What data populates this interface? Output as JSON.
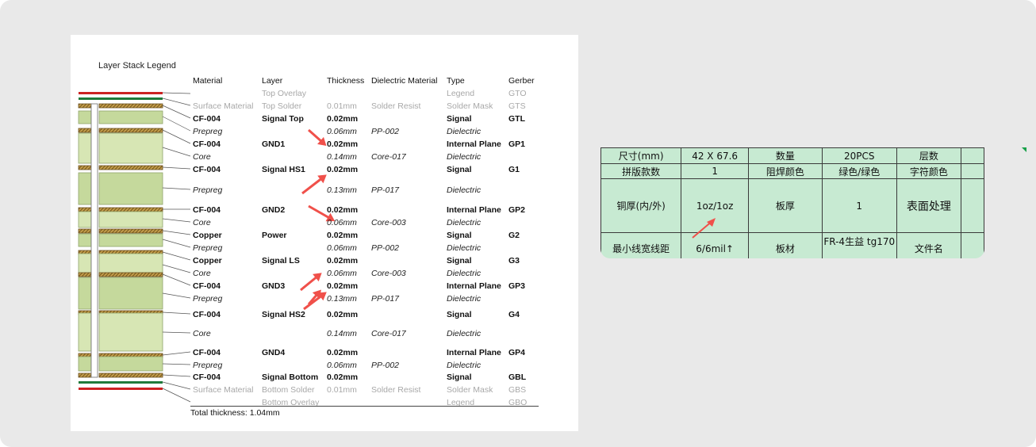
{
  "legend": {
    "title": "Layer Stack Legend",
    "headers": {
      "material": "Material",
      "layer": "Layer",
      "thickness": "Thickness",
      "dielectric": "Dielectric Material",
      "type": "Type",
      "gerber": "Gerber"
    },
    "rows": [
      {
        "style": "gray",
        "material": "",
        "layer": "Top Overlay",
        "thickness": "",
        "dielectric": "",
        "type": "Legend",
        "gerber": "GTO"
      },
      {
        "style": "gray",
        "material": "Surface Material",
        "layer": "Top Solder",
        "thickness": "0.01mm",
        "dielectric": "Solder Resist",
        "type": "Solder Mask",
        "gerber": "GTS"
      },
      {
        "style": "bold",
        "material": "CF-004",
        "layer": "Signal Top",
        "thickness": "0.02mm",
        "dielectric": "",
        "type": "Signal",
        "gerber": "GTL"
      },
      {
        "style": "ital",
        "material": "Prepreg",
        "layer": "",
        "thickness": "0.06mm",
        "dielectric": "PP-002",
        "type": "Dielectric",
        "gerber": ""
      },
      {
        "style": "bold",
        "material": "CF-004",
        "layer": "GND1",
        "thickness": "0.02mm",
        "dielectric": "",
        "type": "Internal Plane",
        "gerber": "GP1"
      },
      {
        "style": "ital",
        "material": "Core",
        "layer": "",
        "thickness": "0.14mm",
        "dielectric": "Core-017",
        "type": "Dielectric",
        "gerber": ""
      },
      {
        "style": "bold",
        "material": "CF-004",
        "layer": "Signal HS1",
        "thickness": "0.02mm",
        "dielectric": "",
        "type": "Signal",
        "gerber": "G1"
      },
      {
        "style": "ital",
        "material": "Prepreg",
        "layer": "",
        "thickness": "0.13mm",
        "dielectric": "PP-017",
        "type": "Dielectric",
        "gerber": ""
      },
      {
        "style": "bold",
        "material": "CF-004",
        "layer": "GND2",
        "thickness": "0.02mm",
        "dielectric": "",
        "type": "Internal Plane",
        "gerber": "GP2"
      },
      {
        "style": "ital",
        "material": "Core",
        "layer": "",
        "thickness": "0.06mm",
        "dielectric": "Core-003",
        "type": "Dielectric",
        "gerber": ""
      },
      {
        "style": "bold",
        "material": "Copper",
        "layer": "Power",
        "thickness": "0.02mm",
        "dielectric": "",
        "type": "Signal",
        "gerber": "G2"
      },
      {
        "style": "ital",
        "material": "Prepreg",
        "layer": "",
        "thickness": "0.06mm",
        "dielectric": "PP-002",
        "type": "Dielectric",
        "gerber": ""
      },
      {
        "style": "bold",
        "material": "Copper",
        "layer": "Signal LS",
        "thickness": "0.02mm",
        "dielectric": "",
        "type": "Signal",
        "gerber": "G3"
      },
      {
        "style": "ital",
        "material": "Core",
        "layer": "",
        "thickness": "0.06mm",
        "dielectric": "Core-003",
        "type": "Dielectric",
        "gerber": ""
      },
      {
        "style": "bold",
        "material": "CF-004",
        "layer": "GND3",
        "thickness": "0.02mm",
        "dielectric": "",
        "type": "Internal Plane",
        "gerber": "GP3"
      },
      {
        "style": "ital",
        "material": "Prepreg",
        "layer": "",
        "thickness": "0.13mm",
        "dielectric": "PP-017",
        "type": "Dielectric",
        "gerber": ""
      },
      {
        "style": "bold",
        "material": "CF-004",
        "layer": "Signal HS2",
        "thickness": "0.02mm",
        "dielectric": "",
        "type": "Signal",
        "gerber": "G4"
      },
      {
        "style": "ital",
        "material": "Core",
        "layer": "",
        "thickness": "0.14mm",
        "dielectric": "Core-017",
        "type": "Dielectric",
        "gerber": ""
      },
      {
        "style": "bold",
        "material": "CF-004",
        "layer": "GND4",
        "thickness": "0.02mm",
        "dielectric": "",
        "type": "Internal Plane",
        "gerber": "GP4"
      },
      {
        "style": "ital",
        "material": "Prepreg",
        "layer": "",
        "thickness": "0.06mm",
        "dielectric": "PP-002",
        "type": "Dielectric",
        "gerber": ""
      },
      {
        "style": "bold",
        "material": "CF-004",
        "layer": "Signal Bottom",
        "thickness": "0.02mm",
        "dielectric": "",
        "type": "Signal",
        "gerber": "GBL"
      },
      {
        "style": "gray",
        "material": "Surface Material",
        "layer": "Bottom Solder",
        "thickness": "0.01mm",
        "dielectric": "Solder Resist",
        "type": "Solder Mask",
        "gerber": "GBS"
      },
      {
        "style": "gray",
        "material": "",
        "layer": "Bottom Overlay",
        "thickness": "",
        "dielectric": "",
        "type": "Legend",
        "gerber": "GBO"
      }
    ],
    "total": "Total thickness: 1.04mm"
  },
  "spec_table": {
    "rows": [
      [
        "尺寸(mm)",
        "42 X 67.6",
        "数量",
        "20PCS",
        "层数"
      ],
      [
        "拼版款数",
        "1",
        "阻焊颜色",
        "绿色/绿色",
        "字符颜色"
      ],
      [
        "铜厚(内/外)",
        "1oz/1oz",
        "板厚",
        "1",
        "表面处理"
      ],
      [
        "最小线宽线距",
        "6/6mil↑",
        "板材",
        "FR-4生益 tg170",
        "文件名"
      ]
    ]
  },
  "colors": {
    "annotation_arrow": "#f0504a",
    "sheet_bg": "#c7ead2",
    "solder_red": "#cc2222",
    "solder_green": "#1f7a3a"
  }
}
